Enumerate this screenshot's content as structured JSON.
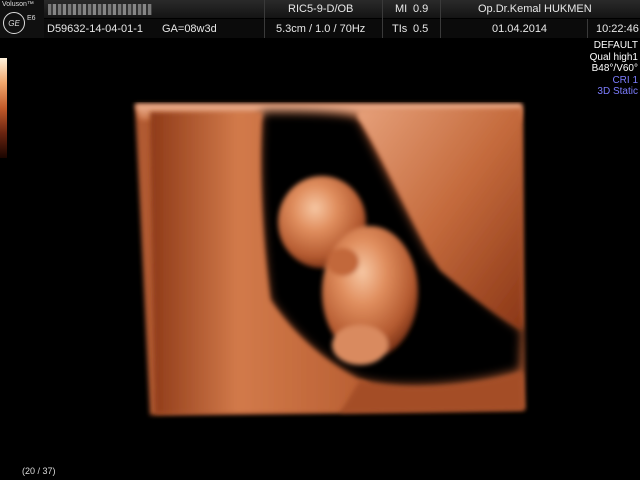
{
  "header": {
    "brand": "Voluson™",
    "logo_text": "GE",
    "model": "E6",
    "patient_id": "D59632-14-04-01-1",
    "gestational_age": "GA=08w3d",
    "probe": "RIC5-9-D/OB",
    "scan_params": "5.3cm / 1.0 / 70Hz",
    "mi": "MI",
    "mi_value": "0.9",
    "tis": "TIs",
    "tis_value": "0.5",
    "doctor": "Op.Dr.Kemal HUKMEN",
    "date": "01.04.2014",
    "time": "10:22:46"
  },
  "settings": [
    {
      "text": "DEFAULT",
      "color": "#ffffff"
    },
    {
      "text": "Qual high1",
      "color": "#ffffff"
    },
    {
      "text": "B48°/V60°",
      "color": "#ffffff"
    },
    {
      "text": "CRI 1",
      "color": "#7d7dff"
    },
    {
      "text": "3D Static",
      "color": "#7d7dff"
    }
  ],
  "footer": {
    "frame_counter": "(20 / 37)"
  },
  "colors": {
    "tissue": "#c8693c",
    "tissue_dark": "#7a2e12",
    "accent_blue": "#7d7dff"
  }
}
